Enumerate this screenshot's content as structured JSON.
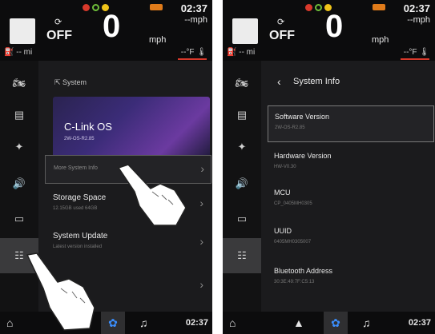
{
  "status": {
    "time": "02:37",
    "top_speed_unit": "--mph",
    "cruise_state": "OFF",
    "speed": "0",
    "speed_unit": "mph",
    "range": "-- mi",
    "temperature": "--°F",
    "warning_colors": [
      "#d8392b",
      "#6fbf3a",
      "#f0c419"
    ],
    "engine_warning_color": "#e07b1a"
  },
  "sidebar_icons": [
    "motorcycle-icon",
    "dashboard-icon",
    "bluetooth-icon",
    "volume-icon",
    "display-icon",
    "settings-sliders-icon"
  ],
  "left": {
    "breadcrumb": "⇱ System",
    "card": {
      "title": "C-Link OS",
      "subtitle": "2W-OS-R2.85"
    },
    "rows": [
      {
        "title": "More System Info",
        "subtitle": ""
      },
      {
        "title": "Storage Space",
        "subtitle": "12.15GB used 64GB"
      },
      {
        "title": "System Update",
        "subtitle": "Latest version installed"
      },
      {
        "title": "",
        "subtitle": ""
      }
    ]
  },
  "right": {
    "back_glyph": "‹",
    "title": "System Info",
    "items": [
      {
        "title": "Software Version",
        "value": "2W-OS-R2.85"
      },
      {
        "title": "Hardware Version",
        "value": "HW-V0.30"
      },
      {
        "title": "MCU",
        "value": "CP_0405MH0305"
      },
      {
        "title": "UUID",
        "value": "0405MH0305007"
      },
      {
        "title": "Bluetooth Address",
        "value": "30:3E:49:7F:C5:13"
      }
    ]
  },
  "bottom_bar": {
    "time": "02:37",
    "icons": [
      "home-icon",
      "navigation-icon",
      "settings-icon",
      "music-icon"
    ],
    "active_color": "#3b8fff"
  }
}
